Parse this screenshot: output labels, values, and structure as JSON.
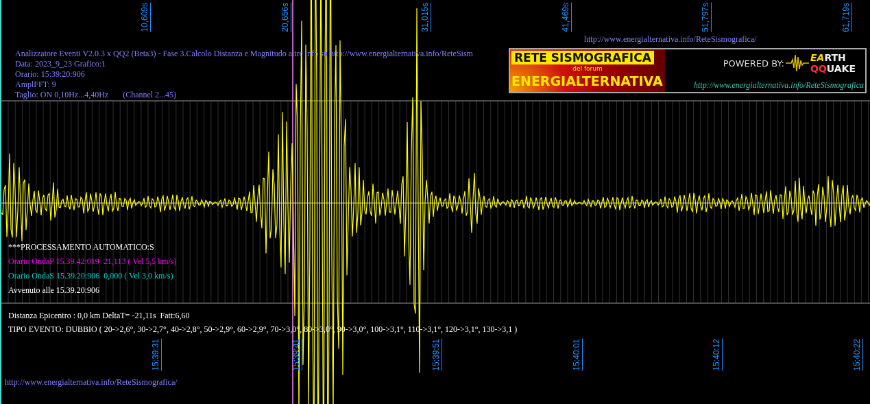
{
  "top_axis": {
    "ticks": [
      "10,609s",
      "20,656s",
      "31,015s",
      "41,469s",
      "51,797s",
      "61,719s"
    ]
  },
  "header_url": "http://www.energialternativa.info/ReteSismografica/",
  "info_lines": [
    "Analizzatore Eventi V2.0.3 x QQ2 (Beta3) - Fase 3.Calcolo Distanza e Magnitudo altre info su http://www.energialternativa.info/ReteSism",
    "Data: 2023_9_23 Grafico:1",
    "Orario: 15:39:20:906",
    "AmplFFT: 9",
    "Taglio: ON 0,10Hz...4,40Hz       (Channel 2...45)"
  ],
  "banner": {
    "title": "RETE SISMOGRAFICA",
    "subtitle": "del forum",
    "name": "ENERGIALTERNATIVA",
    "powered_by": "POWERED BY:",
    "logo_top": "EARTH",
    "logo_bottom": "QQUAKE",
    "url": "http://www.energialternativa.info/ReteSismografica"
  },
  "processing": [
    {
      "text": "***PROCESSAMENTO AUTOMATICO:S",
      "color": "#ffffff"
    },
    {
      "text": "Orario OndaP 15.39.42:019  21,113 ( Vel 5,5 km/s)",
      "color": "#ff00ff"
    },
    {
      "text": "Orario OndaS 15.39.20:906  0,000 ( Vel 3,0 km/s)",
      "color": "#00d0d0"
    },
    {
      "text": "Avvenuto alle 15.39.20:906",
      "color": "#ffffff"
    }
  ],
  "results": [
    "Distanza Epicentro : 0,0 km DeltaT= -21,11s  Fatt:6,60",
    "TIPO EVENTO: DUBBIO ( 20->2,6°, 30->2,7°, 40->2,8°, 50->2,9°, 60->2,9°, 70->3,0°, 80->3,0°, 90->3,0°, 100->3,1°, 110->3,1°, 120->3,1°, 130->3,1 )"
  ],
  "bottom_axis": {
    "ticks": [
      "15:39:31",
      "15:39:41",
      "15:39:51",
      "15:40:01",
      "15:40:12",
      "15:40:22"
    ]
  },
  "footer_url": "http://www.energialternativa.info/ReteSismografica/"
}
